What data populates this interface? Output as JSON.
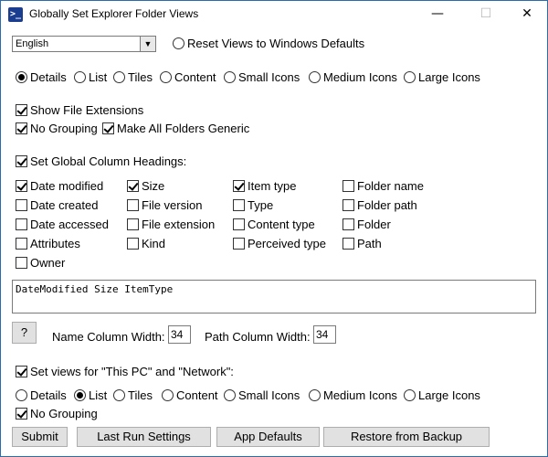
{
  "window": {
    "title": "Globally Set Explorer Folder Views",
    "icon_glyph": ">_",
    "minimize": "—",
    "maximize": "☐",
    "close": "✕"
  },
  "language": {
    "selected": "English"
  },
  "reset_label": "Reset Views to Windows Defaults",
  "view_modes": [
    "Details",
    "List",
    "Tiles",
    "Content",
    "Small Icons",
    "Medium Icons",
    "Large Icons"
  ],
  "view_mode_selected": "Details",
  "options": {
    "show_extensions": "Show File Extensions",
    "no_grouping": "No Grouping",
    "make_generic": "Make All Folders Generic"
  },
  "column_headings": {
    "label": "Set Global Column Headings:",
    "columns": [
      [
        "Date modified",
        "Date created",
        "Date accessed",
        "Attributes",
        "Owner"
      ],
      [
        "Size",
        "File version",
        "File extension",
        "Kind"
      ],
      [
        "Item type",
        "Type",
        "Content type",
        "Perceived type"
      ],
      [
        "Folder name",
        "Folder path",
        "Folder",
        "Path"
      ]
    ],
    "checked": [
      "Date modified",
      "Size",
      "Item type"
    ],
    "text": "DateModified Size ItemType"
  },
  "help_button": "?",
  "name_width": {
    "label": "Name Column Width:",
    "value": "34"
  },
  "path_width": {
    "label": "Path Column Width:",
    "value": "34"
  },
  "this_pc": {
    "label": "Set views for \"This PC\" and \"Network\":",
    "view_modes": [
      "Details",
      "List",
      "Tiles",
      "Content",
      "Small Icons",
      "Medium Icons",
      "Large Icons"
    ],
    "selected": "List",
    "no_grouping": "No Grouping"
  },
  "buttons": {
    "submit": "Submit",
    "last_run": "Last Run Settings",
    "app_defaults": "App Defaults",
    "restore": "Restore from Backup"
  }
}
